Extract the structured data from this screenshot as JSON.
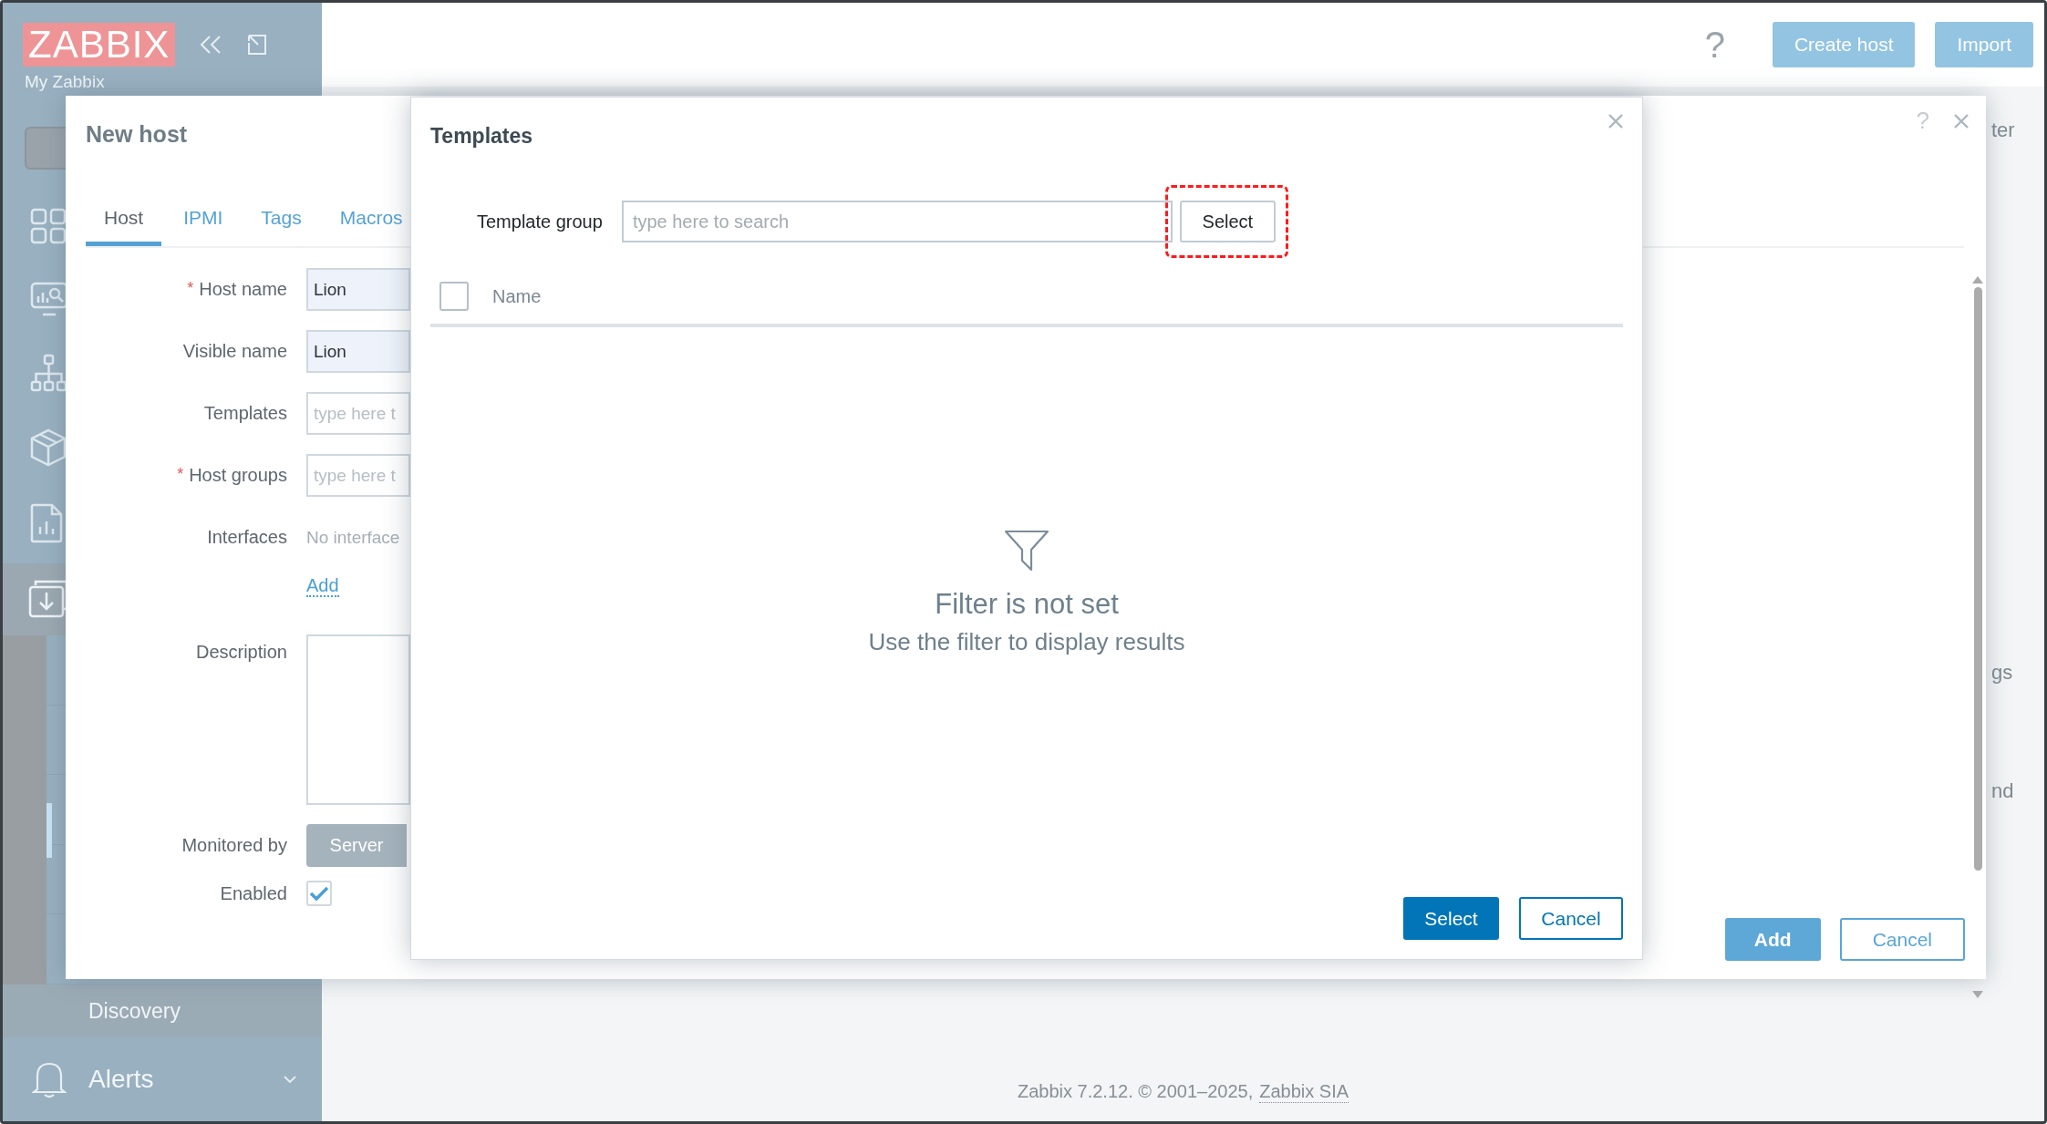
{
  "sidebar": {
    "logo": "ZABBIX",
    "section": "My Zabbix",
    "submenu_item": "Discovery",
    "menu": [
      {
        "label": "Alerts",
        "expanded": false
      }
    ]
  },
  "header": {
    "help": "?",
    "buttons": [
      "Create host",
      "Import"
    ]
  },
  "background_fragments": [
    "ter",
    "gs",
    "nd"
  ],
  "footer": {
    "text": "Zabbix 7.2.12. © 2001–2025,",
    "link": "Zabbix SIA"
  },
  "host_dialog": {
    "title": "New host",
    "help": "?",
    "tabs": [
      {
        "label": "Host",
        "selected": true
      },
      {
        "label": "IPMI",
        "selected": false
      },
      {
        "label": "Tags",
        "selected": false
      },
      {
        "label": "Macros",
        "selected": false
      }
    ],
    "fields": [
      {
        "kind": "input",
        "label": "Host name",
        "required_mark": "*",
        "value": "Lion"
      },
      {
        "kind": "input",
        "label": "Visible name",
        "value": "Lion"
      },
      {
        "kind": "input",
        "label": "Templates",
        "placeholder": "type here t"
      },
      {
        "kind": "input",
        "label": "Host groups",
        "required_mark": "*",
        "placeholder": "type here t"
      },
      {
        "kind": "text",
        "label": "Interfaces",
        "value": "No interface"
      },
      {
        "kind": "link",
        "value": "Add"
      },
      {
        "kind": "textarea",
        "label": "Description"
      },
      {
        "kind": "segmented",
        "label": "Monitored by",
        "options": [
          {
            "label": "Server",
            "selected": true
          }
        ]
      },
      {
        "kind": "checkbox",
        "label": "Enabled",
        "checked": true
      }
    ],
    "buttons": [
      {
        "label": "Add",
        "kind": "primary"
      },
      {
        "label": "Cancel",
        "kind": "secondary"
      }
    ]
  },
  "templates_dialog": {
    "title": "Templates",
    "filter": {
      "label": "Template group",
      "placeholder": "type here to search",
      "button": "Select"
    },
    "table": {
      "select_all_checked": false,
      "columns": [
        "Name"
      ]
    },
    "empty_state": {
      "title": "Filter is not set",
      "subtitle": "Use the filter to display results"
    },
    "buttons": [
      {
        "label": "Select",
        "kind": "primary"
      },
      {
        "label": "Cancel",
        "kind": "secondary"
      }
    ]
  }
}
